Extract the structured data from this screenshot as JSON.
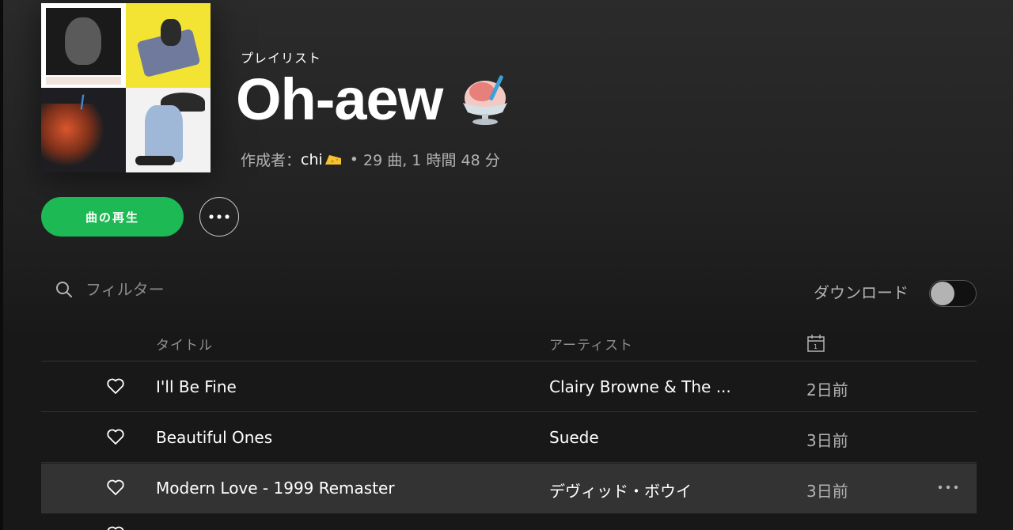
{
  "header": {
    "type_label": "プレイリスト",
    "title": "Oh-aew",
    "title_emoji": "shaved-ice-icon",
    "owner_prefix": "作成者：",
    "owner_name": "chi",
    "owner_emoji": "cheese-icon",
    "stats": "29 曲, 1 時間 48 分"
  },
  "actions": {
    "play_label": "曲の再生",
    "more_icon": "ellipsis-icon"
  },
  "filter": {
    "placeholder": "フィルター",
    "icon": "search-icon"
  },
  "download": {
    "label": "ダウンロード",
    "enabled": false
  },
  "table": {
    "columns": {
      "title": "タイトル",
      "artist": "アーティスト",
      "added_icon": "calendar-icon"
    },
    "rows": [
      {
        "title": "I'll Be Fine",
        "artist": "Clairy Browne & The ...",
        "added": "2日前"
      },
      {
        "title": "Beautiful Ones",
        "artist": "Suede",
        "added": "3日前"
      },
      {
        "title": "Modern Love - 1999 Remaster",
        "artist": "デヴィッド・ボウイ",
        "added": "3日前"
      }
    ]
  },
  "colors": {
    "accent": "#1db954",
    "background": "#181818",
    "row_hover": "#333333",
    "muted_text": "#b3b3b3"
  }
}
